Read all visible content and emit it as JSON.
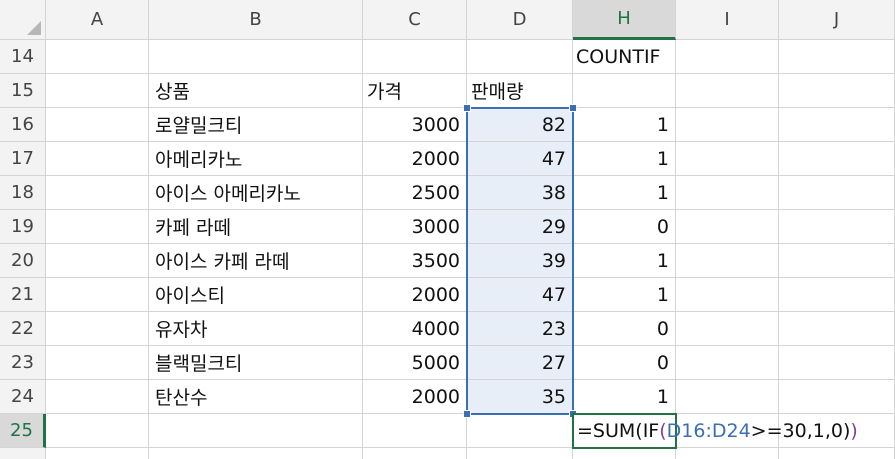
{
  "columns": [
    "A",
    "B",
    "C",
    "D",
    "H",
    "I",
    "J"
  ],
  "active_column": "H",
  "rows": [
    "14",
    "15",
    "16",
    "17",
    "18",
    "19",
    "20",
    "21",
    "22",
    "23",
    "24",
    "25"
  ],
  "active_row": "25",
  "header_countif": "COUNTIF",
  "headers": {
    "product": "상품",
    "price": "가격",
    "sales": "판매량"
  },
  "data_rows": [
    {
      "product": "로얄밀크티",
      "price": "3000",
      "sales": "82",
      "countif": "1"
    },
    {
      "product": "아메리카노",
      "price": "2000",
      "sales": "47",
      "countif": "1"
    },
    {
      "product": "아이스 아메리카노",
      "price": "2500",
      "sales": "38",
      "countif": "1"
    },
    {
      "product": "카페 라떼",
      "price": "3000",
      "sales": "29",
      "countif": "0"
    },
    {
      "product": "아이스 카페 라떼",
      "price": "3500",
      "sales": "39",
      "countif": "1"
    },
    {
      "product": "아이스티",
      "price": "2000",
      "sales": "47",
      "countif": "1"
    },
    {
      "product": "유자차",
      "price": "4000",
      "sales": "23",
      "countif": "0"
    },
    {
      "product": "블랙밀크티",
      "price": "5000",
      "sales": "27",
      "countif": "0"
    },
    {
      "product": "탄산수",
      "price": "2000",
      "sales": "35",
      "countif": "1"
    }
  ],
  "formula": {
    "prefix": "=SUM(IF",
    "open_paren": "(",
    "range_ref": "D16:D24",
    "rest": ">=30,1,0)",
    "close_paren": ")"
  },
  "colors": {
    "accent_green": "#217346",
    "selection_blue": "#3c6eb4",
    "selection_fill": "#e8eef8"
  }
}
